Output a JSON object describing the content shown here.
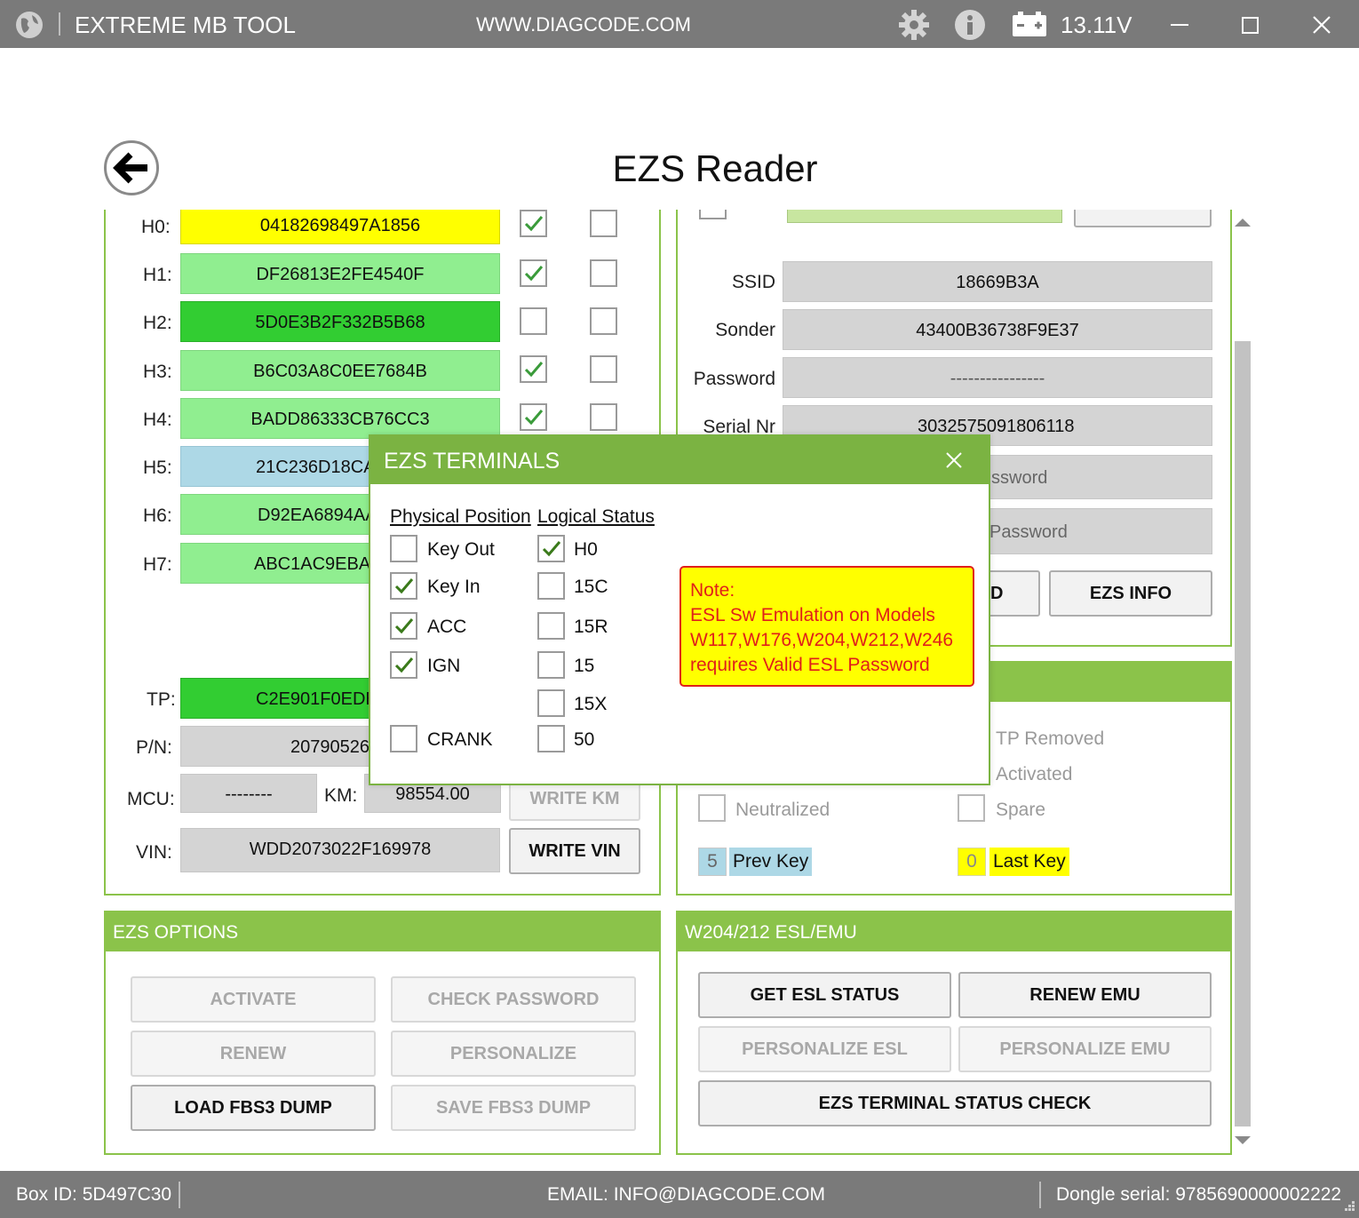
{
  "titlebar": {
    "app_title": "EXTREME MB TOOL",
    "website": "WWW.DIAGCODE.COM",
    "voltage": "13.11V",
    "icons": [
      "globe-icon",
      "gear-icon",
      "info-icon",
      "battery-icon",
      "minimize-icon",
      "maximize-icon",
      "close-icon"
    ]
  },
  "page": {
    "title": "EZS Reader"
  },
  "keys": {
    "rows": [
      {
        "label": "H0:",
        "value": "04182698497A1856",
        "color": "#ffff00",
        "check1": true,
        "check2": false
      },
      {
        "label": "H1:",
        "value": "DF26813E2FE4540F",
        "color": "#90ee90",
        "check1": true,
        "check2": false
      },
      {
        "label": "H2:",
        "value": "5D0E3B2F332B5B68",
        "color": "#32cd32",
        "check1": false,
        "check2": false
      },
      {
        "label": "H3:",
        "value": "B6C03A8C0EE7684B",
        "color": "#90ee90",
        "check1": true,
        "check2": false
      },
      {
        "label": "H4:",
        "value": "BADD86333CB76CC3",
        "color": "#90ee90",
        "check1": true,
        "check2": false
      },
      {
        "label": "H5:",
        "value": "21C236D18CA",
        "color": "#add8e6"
      },
      {
        "label": "H6:",
        "value": "D92EA6894AA",
        "color": "#90ee90"
      },
      {
        "label": "H7:",
        "value": "ABC1AC9EBAA",
        "color": "#90ee90"
      }
    ],
    "tp_label": "TP:",
    "tp_value": "C2E901F0EDB",
    "pn_label": "P/N:",
    "pn_value": "20790526",
    "mcu_label": "MCU:",
    "mcu_value": "--------",
    "km_label": "KM:",
    "km_value": "98554.00",
    "write_km": "WRITE KM",
    "vin_label": "VIN:",
    "vin_value": "WDD2073022F169978",
    "write_vin": "WRITE VIN"
  },
  "info": {
    "ssid_label": "SSID",
    "ssid_value": "18669B3A",
    "sonder_label": "Sonder",
    "sonder_value": "43400B36738F9E37",
    "password_label": "Password",
    "password_value": "----------------",
    "serial_label": "Serial Nr",
    "serial_value": "3032575091806118",
    "field5_partial": "ssword",
    "field6_partial": "Password",
    "btn_partial": "D",
    "ezs_info": "EZS INFO"
  },
  "status": {
    "tp_removed": "TP Removed",
    "activated": "Activated",
    "neutralized": "Neutralized",
    "spare": "Spare",
    "prev_key_num": "5",
    "prev_key": "Prev Key",
    "last_key_num": "0",
    "last_key": "Last Key"
  },
  "ezs_options": {
    "header": "EZS OPTIONS",
    "activate": "ACTIVATE",
    "check_password": "CHECK PASSWORD",
    "renew": "RENEW",
    "personalize": "PERSONALIZE",
    "load_dump": "LOAD FBS3 DUMP",
    "save_dump": "SAVE FBS3 DUMP"
  },
  "esl": {
    "header": "W204/212 ESL/EMU",
    "get_status": "GET ESL STATUS",
    "renew_emu": "RENEW EMU",
    "personalize_esl": "PERSONALIZE ESL",
    "personalize_emu": "PERSONALIZE EMU",
    "terminal_check": "EZS TERMINAL STATUS CHECK"
  },
  "dialog": {
    "title": "EZS TERMINALS",
    "physical_header": "Physical Position",
    "logical_header": "Logical Status",
    "physical": [
      {
        "label": "Key Out",
        "checked": false
      },
      {
        "label": "Key In",
        "checked": true
      },
      {
        "label": "ACC",
        "checked": true
      },
      {
        "label": "IGN",
        "checked": true
      },
      {
        "label": "CRANK",
        "checked": false
      }
    ],
    "logical": [
      {
        "label": "H0",
        "checked": true
      },
      {
        "label": "15C",
        "checked": false
      },
      {
        "label": "15R",
        "checked": false
      },
      {
        "label": "15",
        "checked": false
      },
      {
        "label": "15X",
        "checked": false
      },
      {
        "label": "50",
        "checked": false
      }
    ],
    "note_title": "Note:",
    "note_line1": "ESL Sw Emulation on Models",
    "note_line2": "W117,W176,W204,W212,W246",
    "note_line3": "requires Valid ESL Password"
  },
  "statusbar": {
    "box_id": "Box ID: 5D497C30",
    "email": "EMAIL: INFO@DIAGCODE.COM",
    "dongle": "Dongle serial: 9785690000002222"
  },
  "colors": {
    "accent_green": "#8bc34a",
    "dialog_green": "#7bb342",
    "titlebar_gray": "#7a7a7a",
    "note_red": "#e0201a"
  }
}
